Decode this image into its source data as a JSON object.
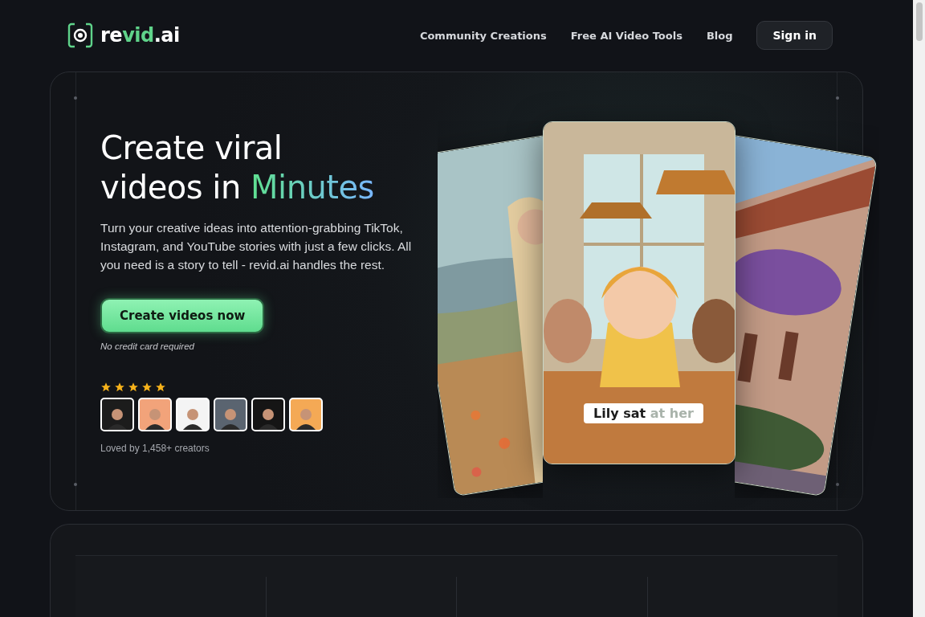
{
  "header": {
    "logo": {
      "prefix": "re",
      "accent": "vid",
      "suffix": ".ai"
    },
    "nav": [
      {
        "label": "Community Creations"
      },
      {
        "label": "Free AI Video Tools"
      },
      {
        "label": "Blog"
      }
    ],
    "sign_in": "Sign in"
  },
  "hero": {
    "title_line1": "Create viral",
    "title_line2": "videos in",
    "title_accent": "Minutes",
    "description": "Turn your creative ideas into attention-grabbing TikTok, Instagram, and YouTube stories with just a few clicks. All you need is a story to tell - revid.ai handles the rest.",
    "cta": "Create videos now",
    "cta_note": "No credit card required",
    "rating": {
      "stars": 5
    },
    "avatars": [
      {
        "color": "#1c1c1c"
      },
      {
        "color": "#f2a37a"
      },
      {
        "color": "#f4f4f4"
      },
      {
        "color": "#5a6470"
      },
      {
        "color": "#151515"
      },
      {
        "color": "#f4a955"
      }
    ],
    "social_proof": "Loved by 1,458+ creators",
    "cards": [
      {
        "kind": "picture"
      },
      {
        "kind": "picture"
      },
      {
        "kind": "picture",
        "caption": {
          "spoken": "Lily sat",
          "pending": "at her"
        }
      }
    ]
  }
}
